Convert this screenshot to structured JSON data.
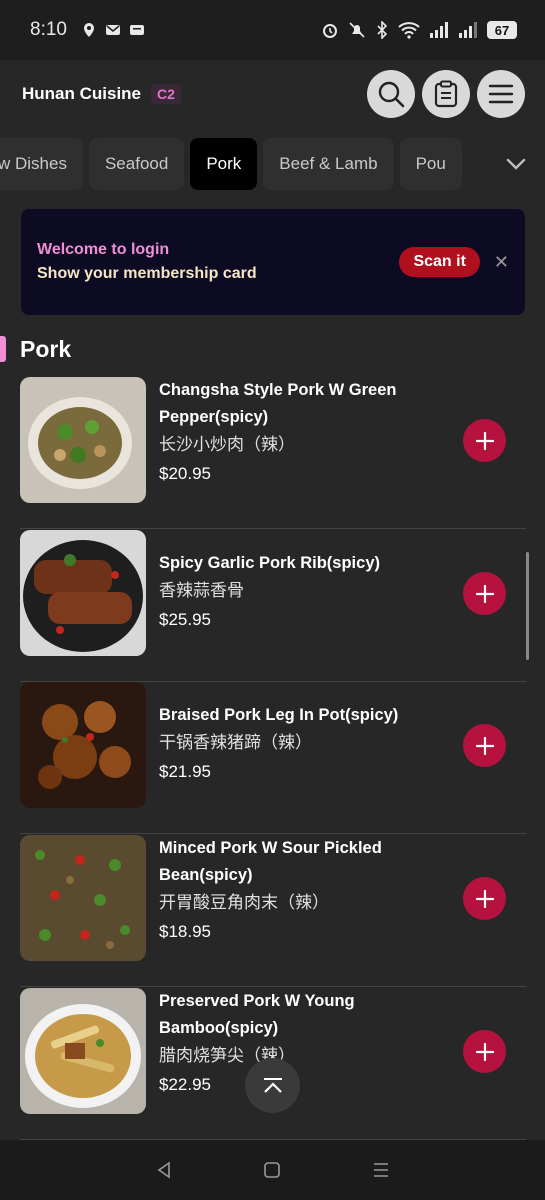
{
  "status_bar": {
    "time": "8:10",
    "battery": "67"
  },
  "header": {
    "store_name": "Hunan Cuisine",
    "store_badge": "C2",
    "icons": [
      "search-icon",
      "clipboard-icon",
      "menu-icon"
    ]
  },
  "tabs": [
    {
      "label": "w Dishes",
      "active": false
    },
    {
      "label": "Seafood",
      "active": false
    },
    {
      "label": "Pork",
      "active": true
    },
    {
      "label": "Beef & Lamb",
      "active": false
    },
    {
      "label": "Pou",
      "active": false
    }
  ],
  "banner": {
    "line1": "Welcome to login",
    "line2": "Show your membership card",
    "scan_label": "Scan it",
    "close_label": "✕"
  },
  "section": {
    "title": "Pork",
    "accent": "#f08fd5"
  },
  "items": [
    {
      "name": "Changsha Style Pork W Green Pepper(spicy)",
      "cn": "长沙小炒肉（辣）",
      "price": "$20.95"
    },
    {
      "name": "Spicy Garlic Pork Rib(spicy)",
      "cn": "香辣蒜香骨",
      "price": "$25.95"
    },
    {
      "name": "Braised Pork Leg In Pot(spicy)",
      "cn": "干锅香辣猪蹄（辣）",
      "price": "$21.95"
    },
    {
      "name": "Minced Pork W Sour Pickled Bean(spicy)",
      "cn": "开胃酸豆角肉末（辣）",
      "price": "$18.95"
    },
    {
      "name": "Preserved Pork W Young Bamboo(spicy)",
      "cn": "腊肉烧笋尖（辣）",
      "price": "$22.95"
    }
  ],
  "colors": {
    "add_button": "#b5123f",
    "scan_button": "#b0101d",
    "banner_bg": "#0d0b24"
  }
}
